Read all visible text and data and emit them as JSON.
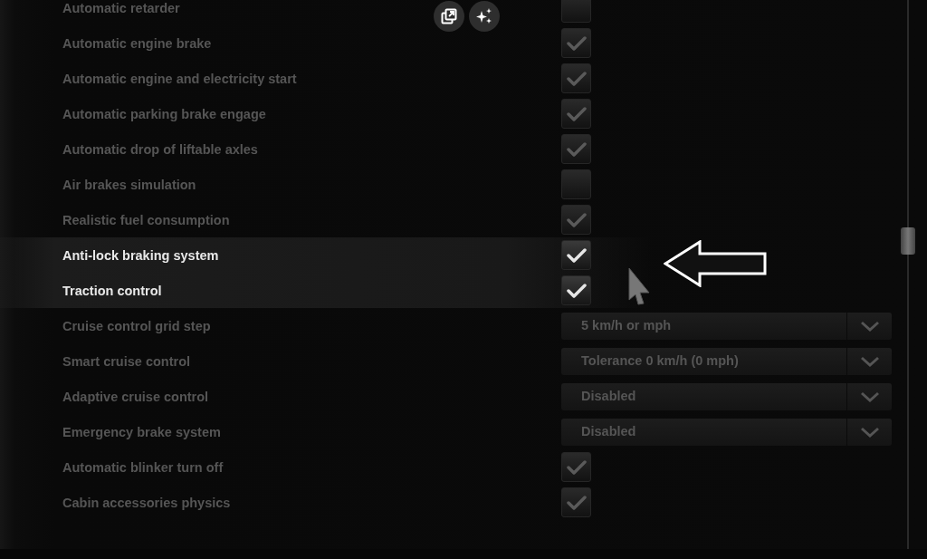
{
  "overlay_buttons": [
    {
      "kind": "popout"
    },
    {
      "kind": "sparkle"
    }
  ],
  "settings": [
    {
      "label": "Automatic retarder",
      "kind": "checkbox",
      "checked": false,
      "highlighted": false
    },
    {
      "label": "Automatic engine brake",
      "kind": "checkbox",
      "checked": true,
      "highlighted": false
    },
    {
      "label": "Automatic engine and electricity start",
      "kind": "checkbox",
      "checked": true,
      "highlighted": false
    },
    {
      "label": "Automatic parking brake engage",
      "kind": "checkbox",
      "checked": true,
      "highlighted": false
    },
    {
      "label": "Automatic drop of liftable axles",
      "kind": "checkbox",
      "checked": true,
      "highlighted": false
    },
    {
      "label": "Air brakes simulation",
      "kind": "checkbox",
      "checked": false,
      "highlighted": false
    },
    {
      "label": "Realistic fuel consumption",
      "kind": "checkbox",
      "checked": true,
      "highlighted": false
    },
    {
      "label": "Anti-lock braking system",
      "kind": "checkbox",
      "checked": true,
      "highlighted": true
    },
    {
      "label": "Traction control",
      "kind": "checkbox",
      "checked": true,
      "highlighted": true
    },
    {
      "label": "Cruise control grid step",
      "kind": "dropdown",
      "value": "5 km/h or mph",
      "highlighted": false
    },
    {
      "label": "Smart cruise control",
      "kind": "dropdown",
      "value": "Tolerance 0 km/h (0 mph)",
      "highlighted": false
    },
    {
      "label": "Adaptive cruise control",
      "kind": "dropdown",
      "value": "Disabled",
      "highlighted": false
    },
    {
      "label": "Emergency brake system",
      "kind": "dropdown",
      "value": "Disabled",
      "highlighted": false
    },
    {
      "label": "Automatic blinker turn off",
      "kind": "checkbox",
      "checked": true,
      "highlighted": false
    },
    {
      "label": "Cabin accessories physics",
      "kind": "checkbox",
      "checked": true,
      "highlighted": false
    }
  ]
}
